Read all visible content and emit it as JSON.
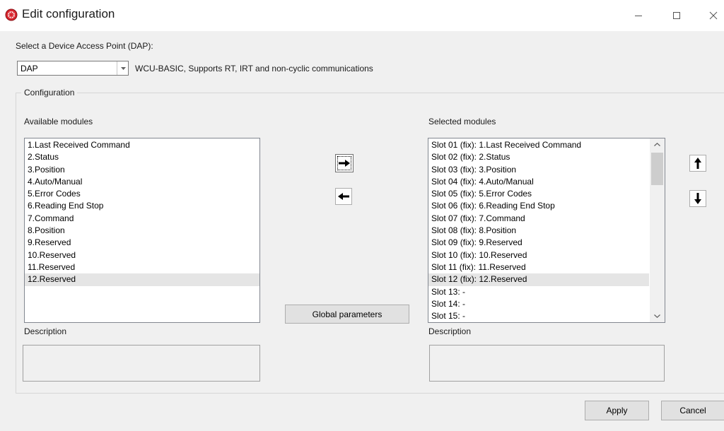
{
  "window": {
    "title": "Edit configuration",
    "icon": "gear-red-icon",
    "minimize_icon": "minimize-icon",
    "maximize_icon": "maximize-icon",
    "close_icon": "close-icon"
  },
  "dap": {
    "label": "Select a Device Access Point (DAP):",
    "selected": "DAP",
    "description": "WCU-BASIC, Supports RT, IRT and non-cyclic communications"
  },
  "configuration": {
    "group_label": "Configuration",
    "available": {
      "label": "Available modules",
      "items": [
        "1.Last Received Command",
        "2.Status",
        "3.Position",
        "4.Auto/Manual",
        "5.Error Codes",
        "6.Reading End Stop",
        "7.Command",
        "8.Position",
        "9.Reserved",
        "10.Reserved",
        "11.Reserved",
        "12.Reserved"
      ],
      "selected_index": 11,
      "description_label": "Description"
    },
    "selected": {
      "label": "Selected modules",
      "items": [
        "Slot 01 (fix): 1.Last Received Command",
        "Slot 02 (fix): 2.Status",
        "Slot 03 (fix): 3.Position",
        "Slot 04 (fix): 4.Auto/Manual",
        "Slot 05 (fix): 5.Error Codes",
        "Slot 06 (fix): 6.Reading End Stop",
        "Slot 07 (fix): 7.Command",
        "Slot 08 (fix): 8.Position",
        "Slot 09 (fix): 9.Reserved",
        "Slot 10 (fix): 10.Reserved",
        "Slot 11 (fix): 11.Reserved",
        "Slot 12 (fix): 12.Reserved",
        "Slot 13: -",
        "Slot 14: -",
        "Slot 15: -"
      ],
      "selected_index": 11,
      "description_label": "Description"
    },
    "global_parameters_label": "Global parameters",
    "add_icon": "arrow-right-icon",
    "remove_icon": "arrow-left-icon",
    "move_up_icon": "arrow-up-icon",
    "move_down_icon": "arrow-down-icon"
  },
  "footer": {
    "apply_label": "Apply",
    "cancel_label": "Cancel"
  },
  "colors": {
    "dialog_bg": "#f0f0f0",
    "focus_border": "#0078d7",
    "selection_bg": "#e5e5e5",
    "icon_red": "#d9262e"
  }
}
